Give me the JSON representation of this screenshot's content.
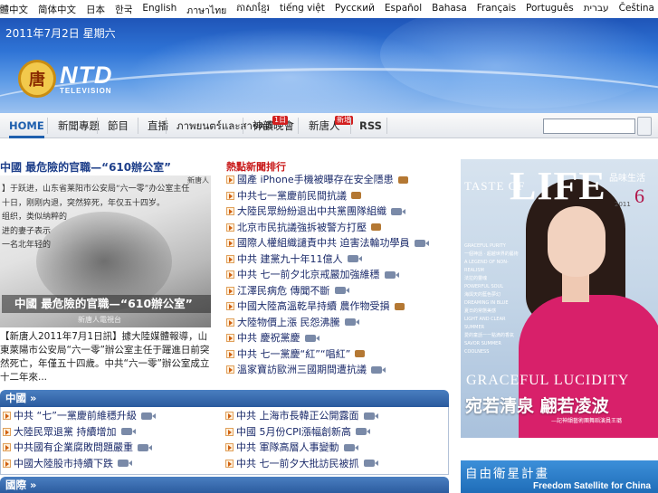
{
  "languages": [
    "繁體中文",
    "简体中文",
    "日本",
    "한국",
    "English",
    "ภาษาไทย",
    "ភាសាខ្មែរ",
    "tiếng việt",
    "Русский",
    "Español",
    "Bahasa",
    "Français",
    "Português",
    "עברית",
    "Čeština"
  ],
  "banner": {
    "date": "2011年7月2日 星期六",
    "logo_seal": "唐",
    "logo_text": "NTD",
    "logo_sub": "TELEVISION"
  },
  "nav": {
    "items": [
      "HOME",
      "新聞專題",
      "節目",
      "直播",
      "ภาพยนตร์และสารคดี",
      "神韻晚會",
      "新唐人",
      "RSS"
    ],
    "badges": [
      "1日",
      "新增"
    ],
    "search_placeholder": ""
  },
  "feature": {
    "title": "中國 最危險的官職—“610辦公室”",
    "image_text": [
      "】于跃进，山东省莱阳市公安局“六一零”办公室主任",
      "十日，刚刚内退，突然猝死，年仅五十四岁。",
      "组织，类似纳粹的",
      "进的妻子表示",
      "一名北年轻的",
      "",
      ""
    ],
    "image_caption": "中國 最危險的官職—“610辦公室”",
    "image_sub": "新唐人電視台",
    "image_corner": "新唐人",
    "description": "【新唐人2011年7月1日訊】據大陸媒體報導，山東萊陽市公安局“六一零”辦公室主任于躍進日前突然死亡，年僅五十四歲。中共“六一零”辦公室成立十二年來..."
  },
  "hot": {
    "title": "熱點新聞排行",
    "items": [
      {
        "text": "國產 iPhone手機被曝存在安全隱患",
        "media": "cam"
      },
      {
        "text": "中共七一黨慶前民間抗議",
        "media": "cam"
      },
      {
        "text": "大陸民眾紛紛退出中共黨團隊組織",
        "media": "vid"
      },
      {
        "text": "北京市民抗議強拆被警方打壓",
        "media": "cam"
      },
      {
        "text": "國際人權組織譴責中共 迫害法輪功學員",
        "media": "vid"
      },
      {
        "text": "中共 建黨九十年11億人",
        "media": "vid"
      },
      {
        "text": "中共 七一前夕北京戒嚴加強維穩",
        "media": "vid"
      },
      {
        "text": "江澤民病危 傳聞不斷",
        "media": "vid"
      },
      {
        "text": "中國大陸高溫乾旱持續 農作物受損",
        "media": "cam"
      },
      {
        "text": "大陸物價上漲 民怨沸騰",
        "media": "vid"
      },
      {
        "text": "中共 慶祝黨慶",
        "media": "vid"
      },
      {
        "text": "中共 七一黨慶“紅”“唱紅”",
        "media": "cam"
      },
      {
        "text": "溫家寶訪歐洲三國期間遭抗議",
        "media": "vid"
      }
    ]
  },
  "sections": [
    {
      "title": "中國 »",
      "left": [
        {
          "text": "中共 “七”一黨慶前維穩升級",
          "media": "vid"
        },
        {
          "text": "大陸民眾退黨 持續增加",
          "media": "vid"
        },
        {
          "text": "中共國有企業腐敗問題嚴重",
          "media": "vid"
        },
        {
          "text": "中國大陸股市持續下跌",
          "media": "vid"
        }
      ],
      "right": [
        {
          "text": "中共 上海市長韓正公開露面",
          "media": "vid"
        },
        {
          "text": "中國 5月份CPI漲幅創新高",
          "media": "vid"
        },
        {
          "text": "中共 軍隊高層人事變動",
          "media": "vid"
        },
        {
          "text": "中共 七一前夕大批訪民被抓",
          "media": "vid"
        }
      ]
    },
    {
      "title": "國際 »",
      "left": [],
      "right": []
    }
  ],
  "ad": {
    "taste": "TASTE OF",
    "life": "LIFE",
    "zh_life": "品味生活",
    "issue": "6",
    "year": "2011",
    "menu": [
      "GRACEFUL PURITY",
      "一個神話 · 超越世界的藝術",
      "A LEGEND OF NON-REALISM",
      "法拉的靈魂",
      "POWERFUL SOUL",
      "海與天的藍色夢幻",
      "DREAMING IN BLUE",
      "夏日的常態美感",
      "LIGHT AND CLEAR SUMMER",
      "愛的童話一一點滴的香氣",
      "SAVOR SUMMER COOLNESS"
    ],
    "grace": "GRACEFUL LUCIDITY",
    "bigzh": "宛若清泉  翩若凌波",
    "small": "—記神韻藝術團舞蹈演員王璐"
  },
  "satellite": {
    "title": "自由衛星計畫",
    "subtitle": "Freedom Satellite for China"
  }
}
